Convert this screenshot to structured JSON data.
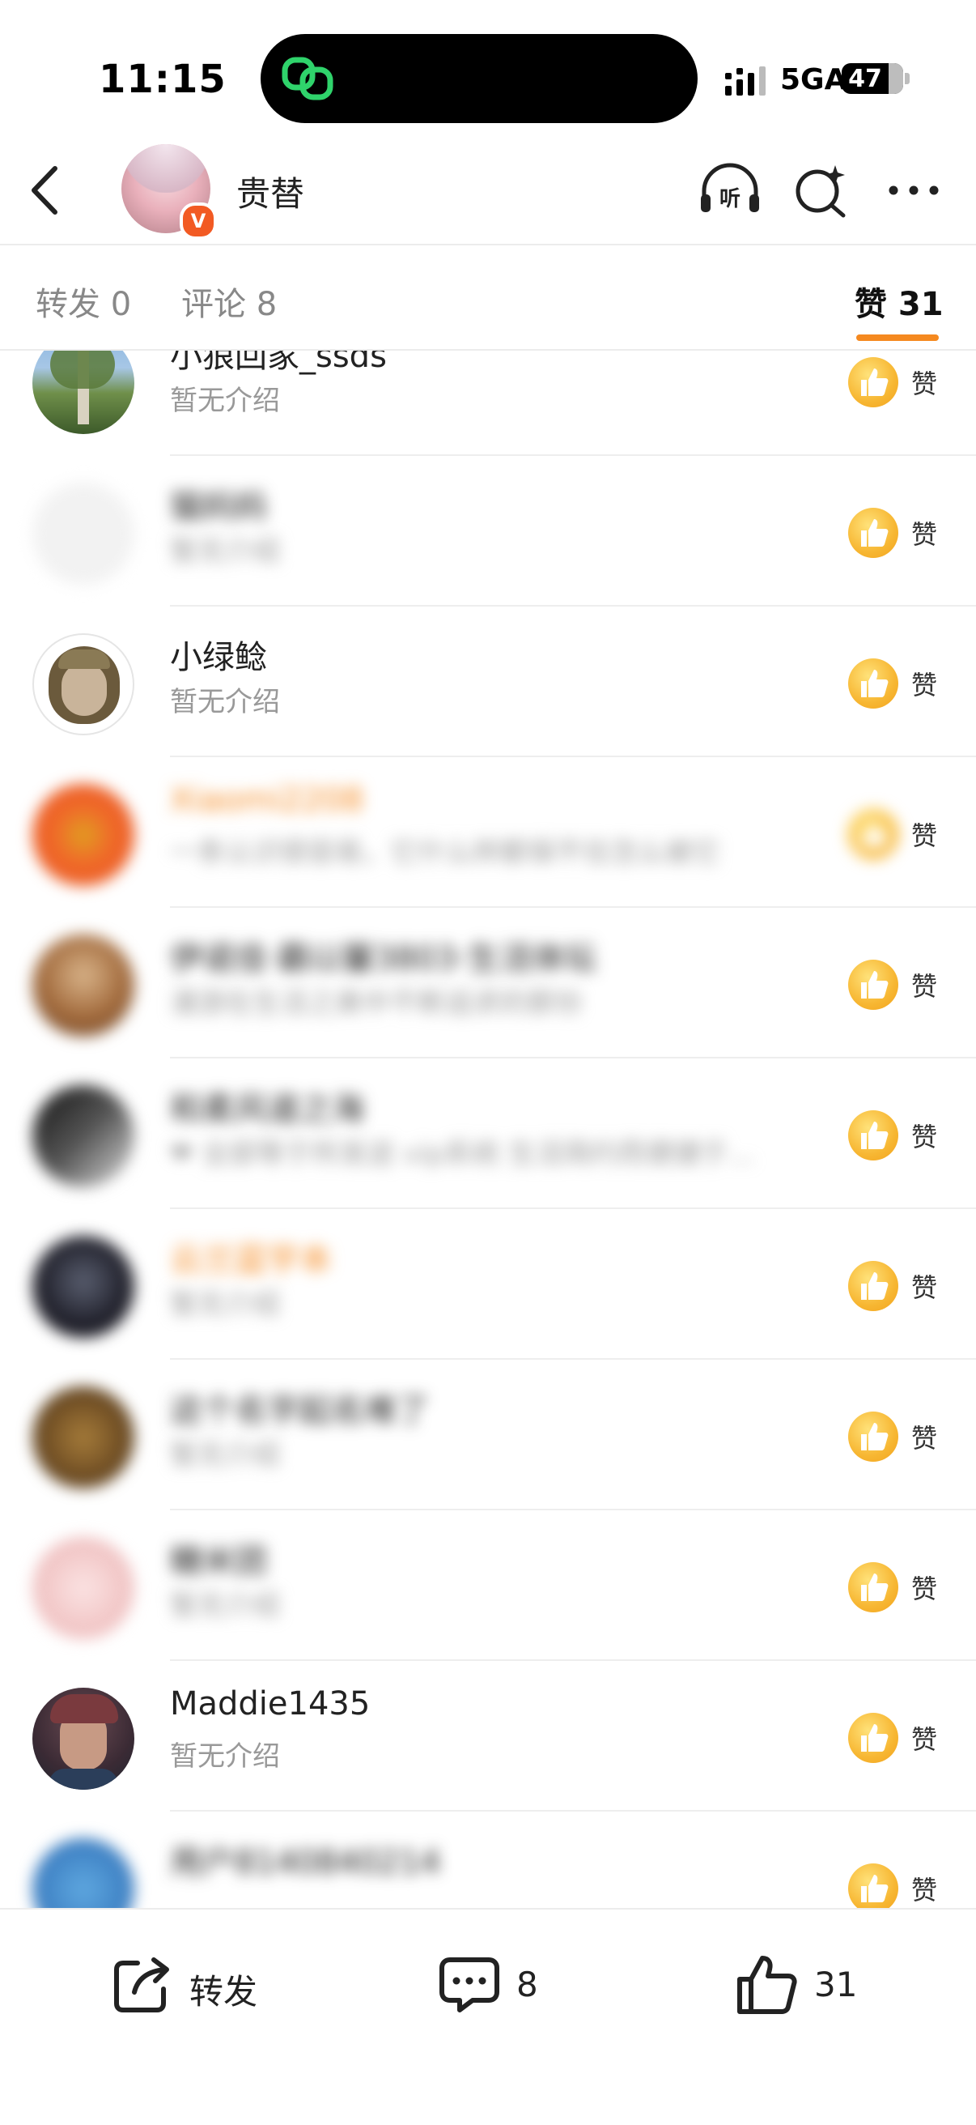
{
  "status_bar": {
    "time": "11:15",
    "network": "5GA",
    "battery": "47"
  },
  "header": {
    "username": "贵替",
    "verified_badge": "V"
  },
  "tabs": [
    {
      "label": "转发 0"
    },
    {
      "label": "评论 8"
    },
    {
      "label": "赞 31"
    }
  ],
  "likers": [
    {
      "name": "小狼回家_ssds",
      "bio": "暂无介绍",
      "action": "赞"
    },
    {
      "name": "猫妈妈",
      "bio": "暂无介绍",
      "action": "赞"
    },
    {
      "name": "小绿鲶",
      "bio": "暂无介绍",
      "action": "赞"
    },
    {
      "name": "Xiaomi2208",
      "bio": "一条认识很容易，它什么样都保不住怎么被它",
      "action": "赞"
    },
    {
      "name": "伊诺佳·霸以馨3803·生活体坛",
      "bio": "漫游在生活之美中不断追求的那份",
      "action": "赞"
    },
    {
      "name": "和柔风道之海",
      "bio": "❤ 全部等于所发送 vip系统 生活简约而便捷于...",
      "action": "赞"
    },
    {
      "name": "云兰蓝宇本",
      "bio": "暂无介绍",
      "action": "赞"
    },
    {
      "name": "这个名字起名难了",
      "bio": "暂无介绍",
      "action": "赞"
    },
    {
      "name": "糖米团",
      "bio": "暂无介绍",
      "action": "赞"
    },
    {
      "name": "Maddie1435",
      "bio": "暂无介绍",
      "action": "赞"
    },
    {
      "name": "用户8140840214",
      "bio": "",
      "action": "赞"
    }
  ],
  "bottom_bar": {
    "repost_label": "转发",
    "comment_count": "8",
    "like_count": "31"
  },
  "colors": {
    "accent": "#f5891f",
    "verified": "#f25a23",
    "like_badge": "#f7b733"
  },
  "icons": [
    "back-icon",
    "listen-icon",
    "ai-search-icon",
    "more-icon",
    "thumbs-up-icon",
    "share-icon",
    "comment-icon"
  ]
}
